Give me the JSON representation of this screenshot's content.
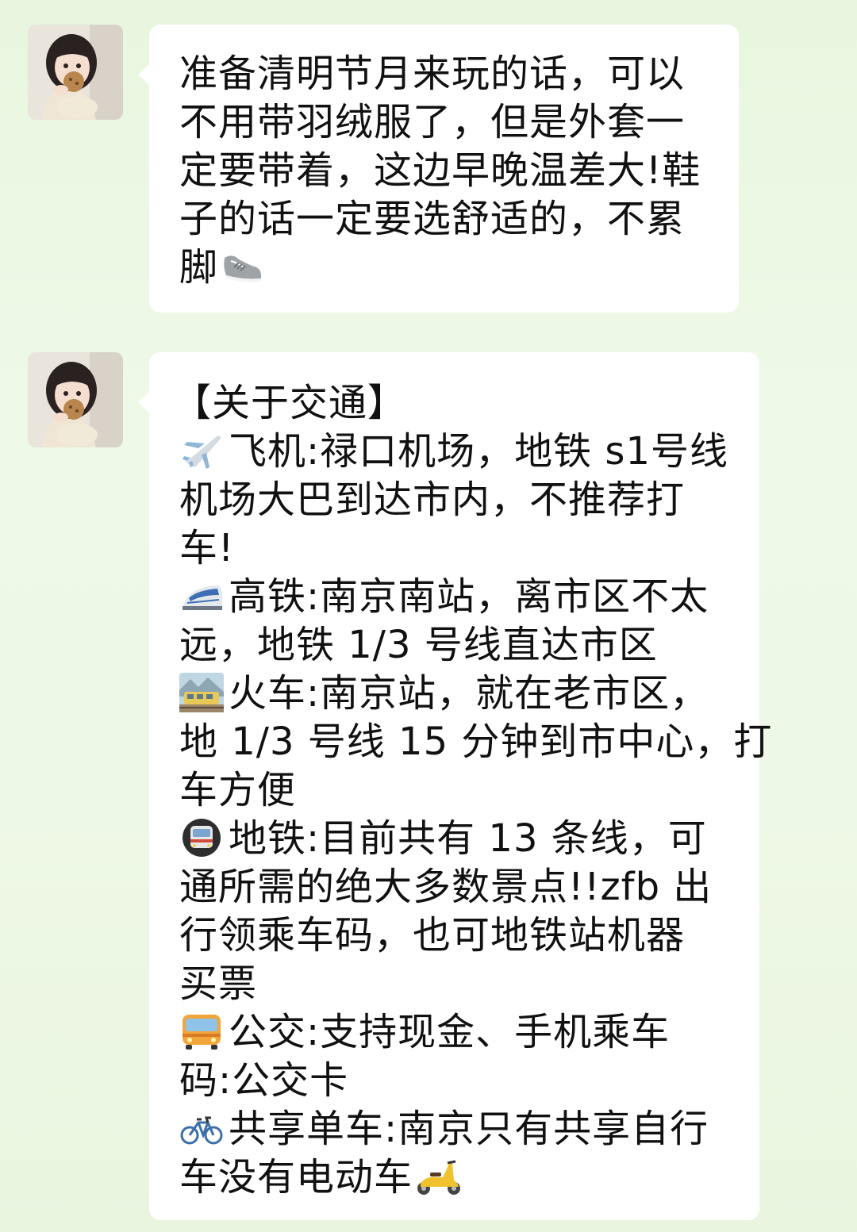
{
  "messages": [
    {
      "sender": "other",
      "lines": [
        "准备清明节月来玩的话，可以",
        "不用带羽绒服了，但是外套一",
        "定要带着，这边早晚温差大!鞋",
        "子的话一定要选舒适的，不累",
        "脚"
      ],
      "trailing_icon": "sneaker-icon"
    },
    {
      "sender": "other",
      "heading": "【关于交通】",
      "items": [
        {
          "icon": "airplane-icon",
          "lines": [
            "飞机:禄口机场，地铁 s1号线",
            "机场大巴到达市内，不推荐打",
            "车!"
          ]
        },
        {
          "icon": "bullet-train-icon",
          "lines": [
            "高铁:南京南站，离市区不太",
            "远，地铁 1/3 号线直达市区"
          ]
        },
        {
          "icon": "train-icon",
          "lines": [
            "火车:南京站，就在老市区，",
            "地 1/3 号线 15 分钟到市中心，打",
            "车方便"
          ]
        },
        {
          "icon": "metro-icon",
          "lines": [
            "地铁:目前共有 13 条线，可",
            "通所需的绝大多数景点!!zfb 出",
            "行领乘车码，也可地铁站机器",
            "买票"
          ]
        },
        {
          "icon": "bus-icon",
          "lines": [
            "公交:支持现金、手机乘车",
            "码:公交卡"
          ]
        },
        {
          "icon": "bicycle-icon",
          "lines": [
            "共享单车:南京只有共享自行",
            "车没有电动车"
          ],
          "trailing_icon": "scooter-icon"
        }
      ]
    }
  ],
  "colors": {
    "background": "#eaf6e2",
    "bubble": "#ffffff",
    "text": "#111111"
  }
}
